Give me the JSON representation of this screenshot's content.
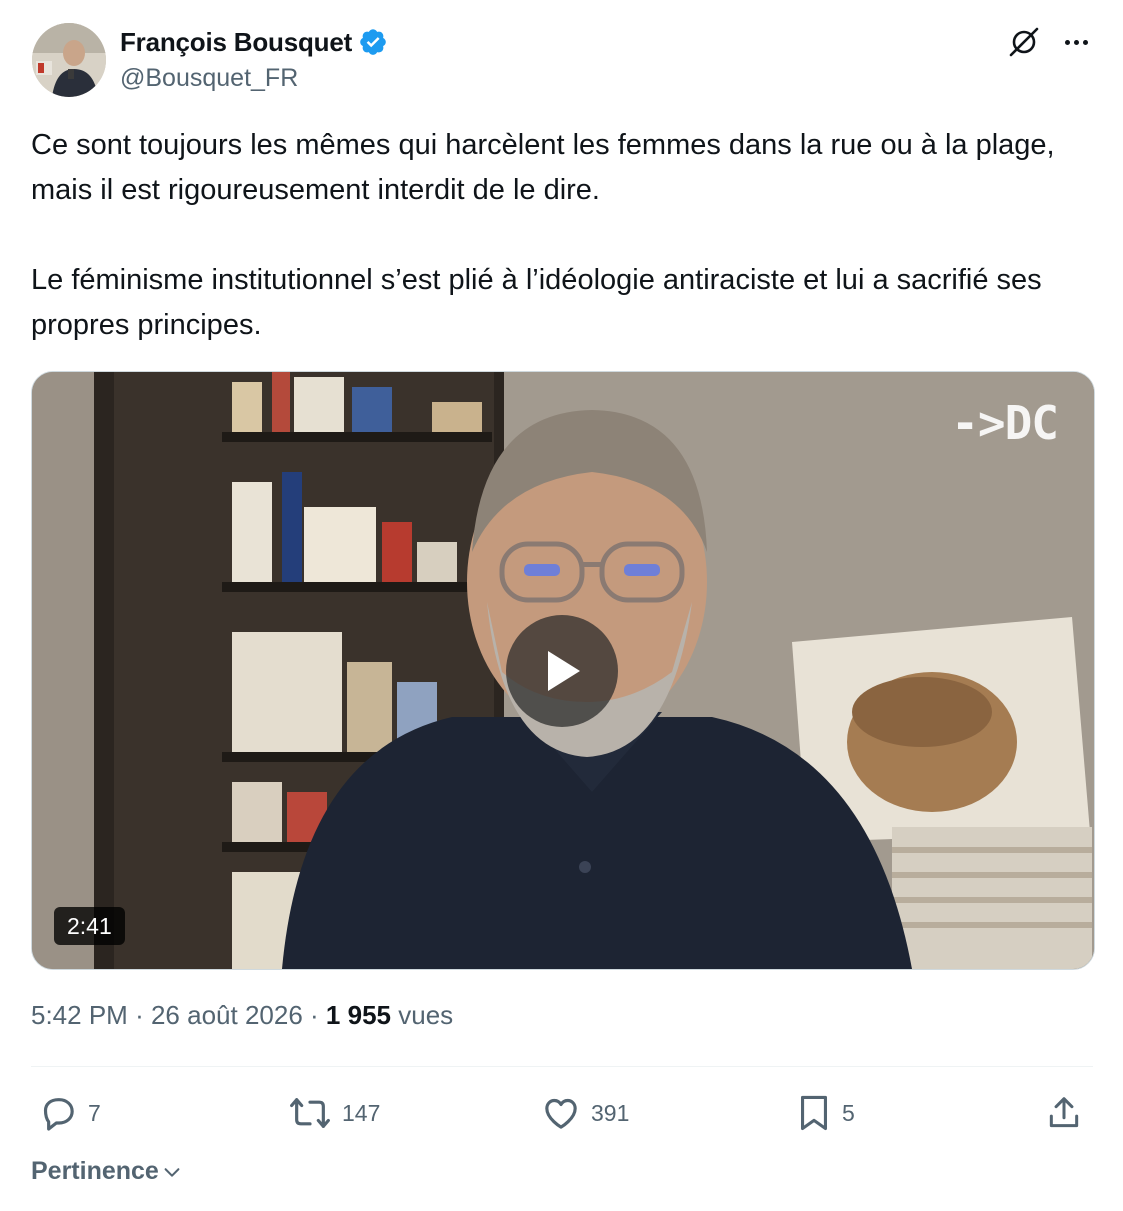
{
  "author": {
    "name": "François Bousquet",
    "handle": "@Bousquet_FR",
    "verified_color": "#1d9bf0"
  },
  "header": {
    "icons": [
      "grok-icon",
      "more-icon"
    ]
  },
  "tweet": {
    "text": "Ce sont toujours les mêmes qui harcèlent les femmes dans la rue ou à la plage, mais il est rigoureusement interdit de le dire.\n\nLe féminisme institutionnel s’est plié à l’idéologie antiraciste et lui a sacrifié ses propres principes."
  },
  "video": {
    "duration": "2:41",
    "watermark": "->DC"
  },
  "meta": {
    "time": "5:42 PM",
    "separator": "·",
    "date": "26 août 2026",
    "views_count": "1 955",
    "views_label": "vues"
  },
  "actions": {
    "replies": "7",
    "reposts": "147",
    "likes": "391",
    "bookmarks": "5"
  },
  "sort": {
    "label": "Pertinence"
  },
  "colors": {
    "text": "#0f1419",
    "secondary": "#536471",
    "accent": "#1d9bf0"
  }
}
